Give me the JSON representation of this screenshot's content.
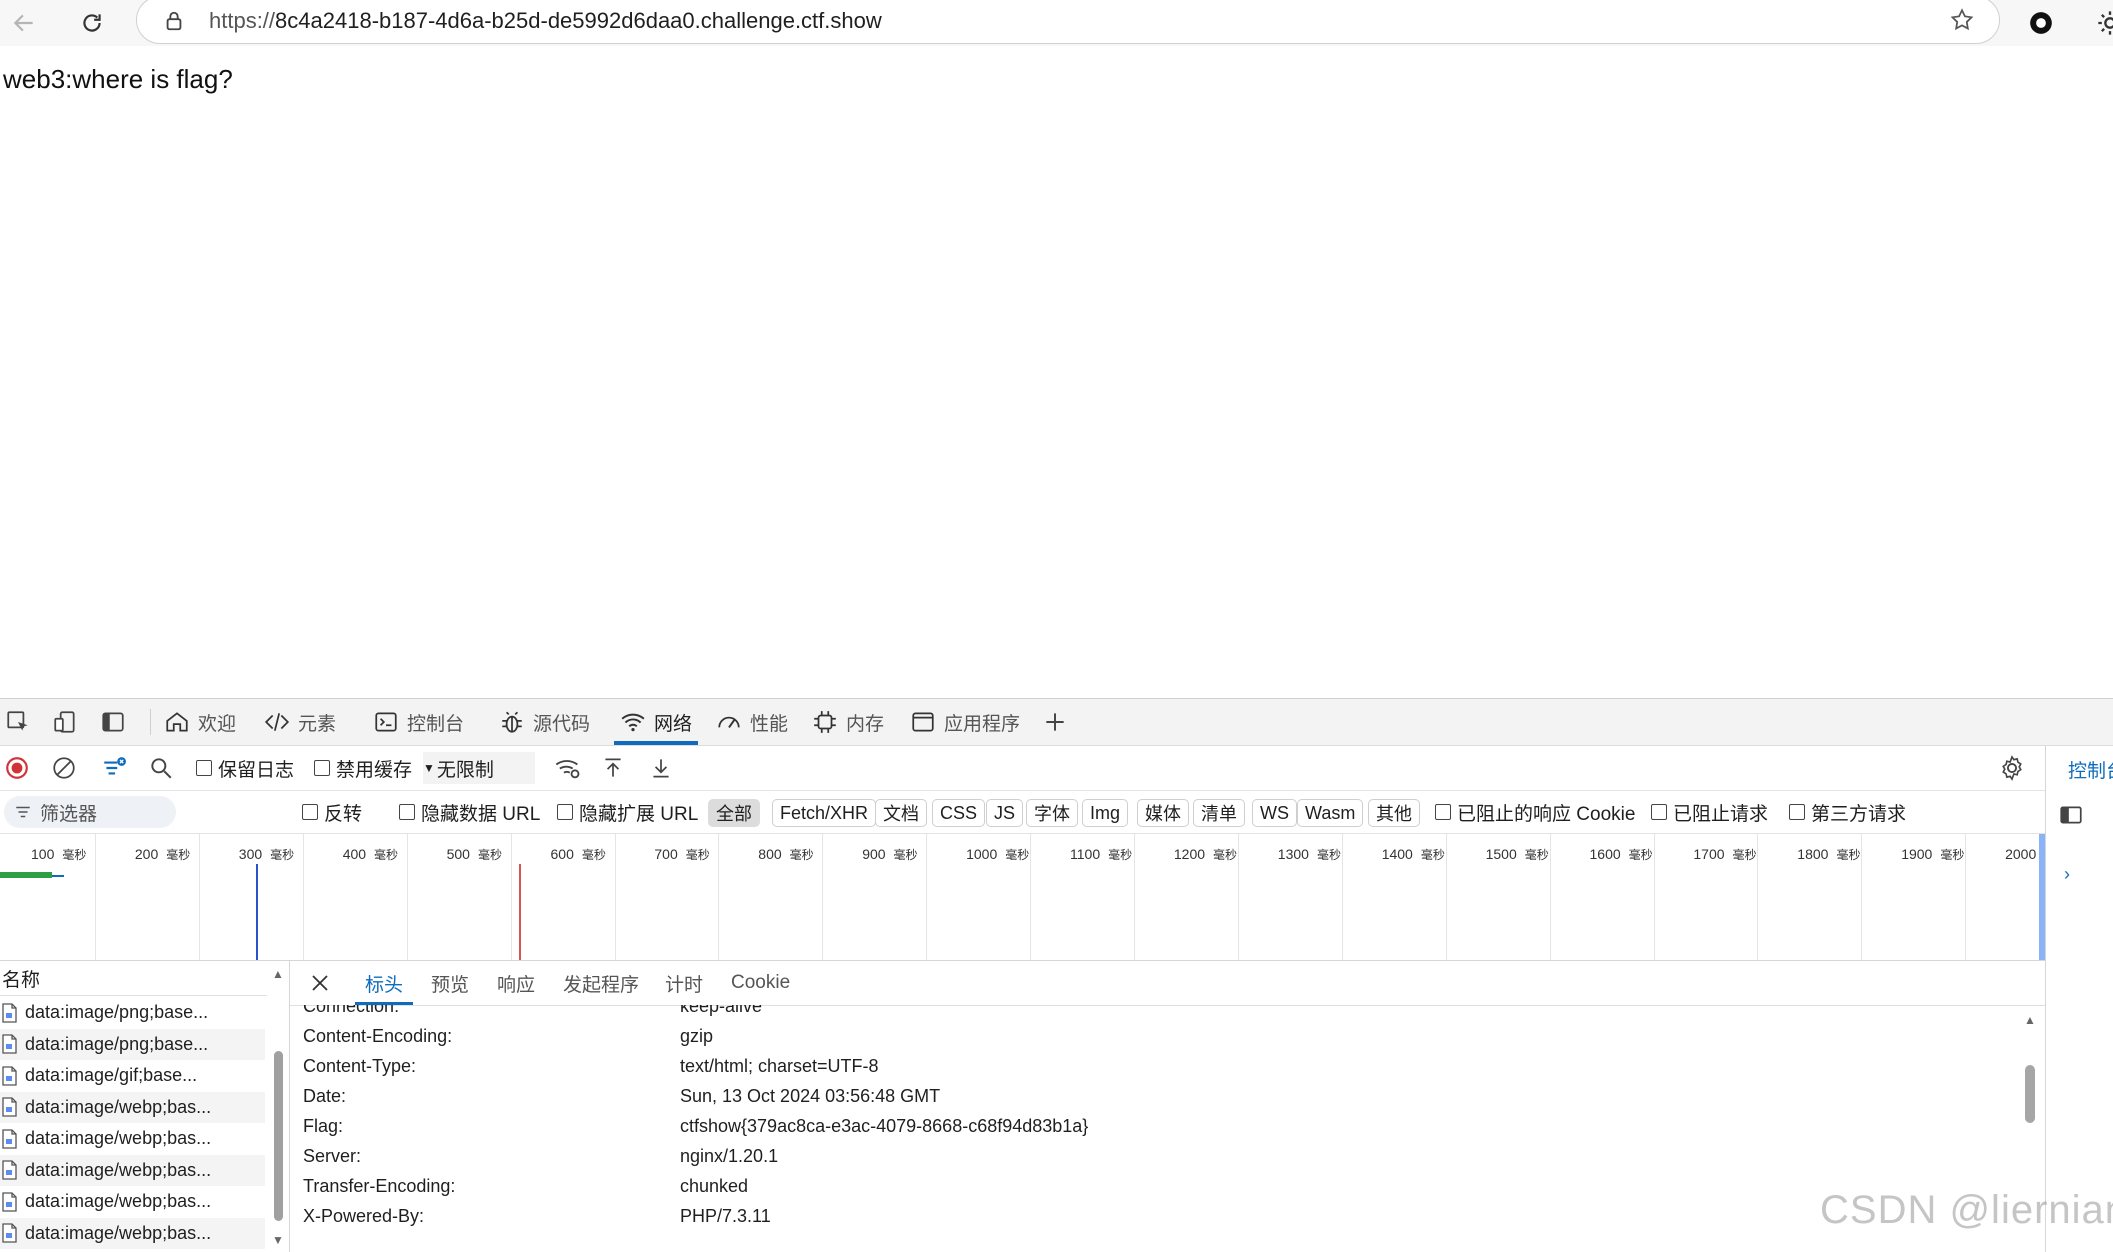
{
  "browser": {
    "url_scheme": "https://",
    "url_host": "8c4a2418-b187-4d6a-b25d-de5992d6daa0.challenge.ctf.show"
  },
  "page": {
    "text": "web3:where is flag?"
  },
  "devtools": {
    "tabs": [
      {
        "label": "欢迎",
        "icon": "home-icon"
      },
      {
        "label": "元素",
        "icon": "code-icon"
      },
      {
        "label": "控制台",
        "icon": "console-icon"
      },
      {
        "label": "源代码",
        "icon": "bug-icon"
      },
      {
        "label": "网络",
        "icon": "wifi-icon",
        "active": true
      },
      {
        "label": "性能",
        "icon": "gauge-icon"
      },
      {
        "label": "内存",
        "icon": "chip-icon"
      },
      {
        "label": "应用程序",
        "icon": "window-icon"
      }
    ],
    "network_toolbar": {
      "preserve_log": "保留日志",
      "disable_cache": "禁用缓存",
      "throttle": "无限制"
    },
    "filter": {
      "placeholder": "筛选器",
      "invert": "反转",
      "hide_data_urls": "隐藏数据 URL",
      "hide_ext_urls": "隐藏扩展 URL",
      "types": [
        "全部",
        "Fetch/XHR",
        "文档",
        "CSS",
        "JS",
        "字体",
        "Img",
        "媒体",
        "清单",
        "WS",
        "Wasm",
        "其他"
      ],
      "active_type": "全部",
      "blocked_cookies": "已阻止的响应 Cookie",
      "blocked_requests": "已阻止请求",
      "third_party": "第三方请求"
    },
    "timeline": {
      "unit": "毫秒",
      "ticks": [
        "100",
        "200",
        "300",
        "400",
        "500",
        "600",
        "700",
        "800",
        "900",
        "1000",
        "1100",
        "1200",
        "1300",
        "1400",
        "1500",
        "1600",
        "1700",
        "1800",
        "1900",
        "2000"
      ]
    },
    "request_list": {
      "header": "名称",
      "rows": [
        "data:image/png;base...",
        "data:image/png;base...",
        "data:image/gif;base...",
        "data:image/webp;bas...",
        "data:image/webp;bas...",
        "data:image/webp;bas...",
        "data:image/webp;bas...",
        "data:image/webp;bas..."
      ]
    },
    "details": {
      "tabs": [
        "标头",
        "预览",
        "响应",
        "发起程序",
        "计时",
        "Cookie"
      ],
      "active_tab": "标头",
      "headers": [
        {
          "key": "Connection:",
          "value": "keep-alive"
        },
        {
          "key": "Content-Encoding:",
          "value": "gzip"
        },
        {
          "key": "Content-Type:",
          "value": "text/html; charset=UTF-8"
        },
        {
          "key": "Date:",
          "value": "Sun, 13 Oct 2024 03:56:48 GMT"
        },
        {
          "key": "Flag:",
          "value": "ctfshow{379ac8ca-e3ac-4079-8668-c68f94d83b1a}"
        },
        {
          "key": "Server:",
          "value": "nginx/1.20.1"
        },
        {
          "key": "Transfer-Encoding:",
          "value": "chunked"
        },
        {
          "key": "X-Powered-By:",
          "value": "PHP/7.3.11"
        }
      ]
    },
    "right_panel_label": "控制台"
  },
  "watermark": "CSDN @liernian",
  "colors": {
    "accent": "#0f6cbd",
    "record": "#d13438",
    "waterfall_green": "#2ea043"
  }
}
